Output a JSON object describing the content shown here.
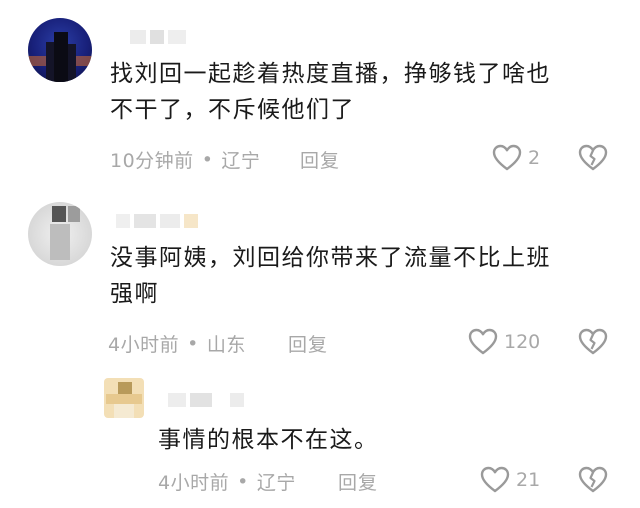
{
  "comments": [
    {
      "text_line1": "找刘回一起趁着热度直播，挣够钱了啥也",
      "text_line2": "不干了，不斥候他们了",
      "time": "10分钟前",
      "location": "辽宁",
      "reply_label": "回复",
      "likes": "2",
      "icons": [
        "heart-icon",
        "broken-heart-icon"
      ]
    },
    {
      "text_line1": "没事阿姨，刘回给你带来了流量不比上班",
      "text_line2": "强啊",
      "time": "4小时前",
      "location": "山东",
      "reply_label": "回复",
      "likes": "120",
      "icons": [
        "heart-icon",
        "broken-heart-icon"
      ]
    },
    {
      "text_line1": "事情的根本不在这。",
      "time": "4小时前",
      "location": "辽宁",
      "reply_label": "回复",
      "likes": "21",
      "icons": [
        "heart-icon",
        "broken-heart-icon"
      ]
    }
  ],
  "separator": "•",
  "colors": {
    "text": "#1a1a1a",
    "meta": "#a8a8a8",
    "background": "#ffffff"
  }
}
